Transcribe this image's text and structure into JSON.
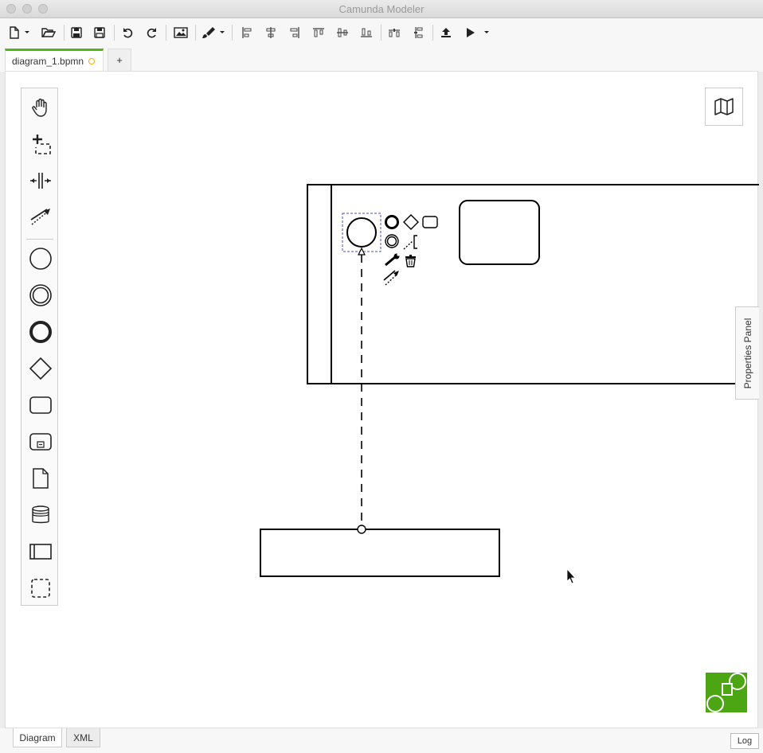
{
  "window": {
    "title": "Camunda Modeler"
  },
  "toolbar": {
    "buttons": [
      "new-file-icon",
      "chevron-down-icon",
      "open-folder-icon",
      "save-icon",
      "save-as-icon",
      "undo-icon",
      "redo-icon",
      "export-image-icon",
      "paint-brush-icon",
      "chevron-down-icon",
      "align-left-icon",
      "align-center-icon",
      "align-right-icon",
      "align-top-icon",
      "align-middle-icon",
      "align-bottom-icon",
      "distribute-horizontal-icon",
      "distribute-vertical-icon",
      "deploy-icon",
      "start-instance-icon",
      "chevron-down-icon"
    ]
  },
  "tabs": {
    "active": {
      "label": "diagram_1.bpmn",
      "unsaved_color": "#f0ad00"
    },
    "add_label": "+"
  },
  "palette": {
    "tools": [
      "hand-tool",
      "lasso-tool",
      "space-tool",
      "global-connect-tool",
      "start-event",
      "intermediate-event",
      "end-event",
      "gateway",
      "task",
      "subprocess",
      "data-object",
      "data-store",
      "participant",
      "group"
    ]
  },
  "properties_panel": {
    "label": "Properties Panel"
  },
  "bottom": {
    "tabs": [
      {
        "label": "Diagram",
        "active": true
      },
      {
        "label": "XML",
        "active": false
      }
    ],
    "log_label": "Log"
  },
  "colors": {
    "brand_green": "#52b415",
    "logo_green": "#4ca512"
  }
}
